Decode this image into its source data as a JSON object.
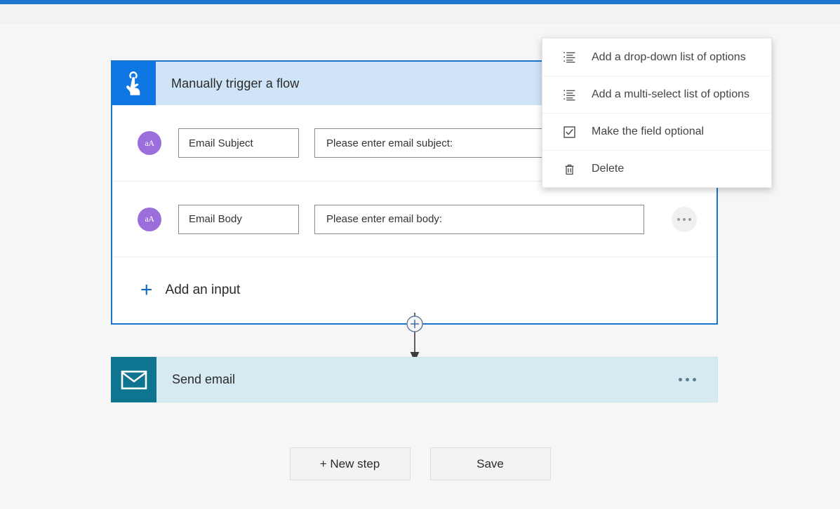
{
  "theme": {
    "top_bar_color": "#1b74cd",
    "canvas_bg": "#f6f6f6",
    "trigger_header_bg": "#cfe4f7",
    "trigger_icon_bg": "#0f77e4",
    "trigger_border": "#1b74cd",
    "avatar_purple": "#9b6edc",
    "send_email_bg": "#d5eaf1",
    "send_email_icon_bg": "#0e7490",
    "accent_link": "#0f6cbd",
    "focus_outline": "#127ad4"
  },
  "trigger_card": {
    "icon": "tap-hand-icon",
    "title": "Manually trigger a flow",
    "menu_icon": "ellipsis-icon",
    "inputs": [
      {
        "avatar_icon": "text-size-aa-icon",
        "name_value": "Email Subject",
        "description_value": "Please enter email subject:",
        "menu_icon": "ellipsis-icon",
        "focused": true
      },
      {
        "avatar_icon": "text-size-aa-icon",
        "name_value": "Email Body",
        "description_value": "Please enter email body:",
        "menu_icon": "ellipsis-icon",
        "focused": false
      }
    ],
    "add_input": {
      "plus": "+",
      "label": "Add an input"
    }
  },
  "connector": {
    "icon": "plus-circle-arrow-icon"
  },
  "send_email_card": {
    "icon": "envelope-icon",
    "title": "Send email",
    "menu_icon": "ellipsis-icon"
  },
  "footer": {
    "new_step_label": "+ New step",
    "save_label": "Save"
  },
  "context_menu": {
    "items": [
      {
        "icon": "ordered-list-icon",
        "label": "Add a drop-down list of options"
      },
      {
        "icon": "ordered-list-icon",
        "label": "Add a multi-select list of options"
      },
      {
        "icon": "checkbox-checked-icon",
        "label": "Make the field optional"
      },
      {
        "icon": "trash-icon",
        "label": "Delete"
      }
    ]
  },
  "cursor": {
    "type": "hand-pointer-cursor"
  }
}
